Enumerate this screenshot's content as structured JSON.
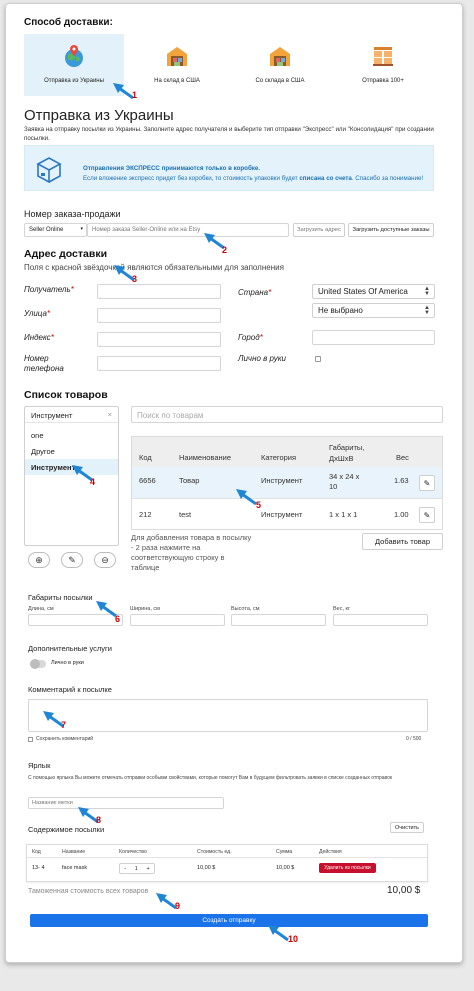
{
  "shipping": {
    "heading": "Способ доставки:",
    "options": [
      {
        "label": "Отправка из Украины",
        "active": true
      },
      {
        "label": "На склад в США",
        "active": false
      },
      {
        "label": "Со склада в США",
        "active": false
      },
      {
        "label": "Отправка 100+",
        "active": false
      }
    ]
  },
  "section": {
    "title": "Отправка из Украины",
    "description": "Заявка на отправку посылки из Украины. Заполните адрес получателя и выберите тип отправки \"Экспресс\" или \"Консолидация\" при создании посылки."
  },
  "banner": {
    "line1": "Отправления ЭКСПРЕСС принимаются только в коробке.",
    "line2_prefix": "Если вложение экспресс придет без коробки, то стоимость упаковки будет ",
    "line2_bold": "списана со счета",
    "line2_suffix": ". Спасибо за понимание!",
    "icon": "box-icon"
  },
  "order": {
    "label": "Номер заказа-продажи",
    "source_value": "Seller Online",
    "input_placeholder": "Номер заказа Seller-Online или на Etsy",
    "load_address": "Загрузить адрес",
    "load_available": "Загрузить доступные заказы"
  },
  "address": {
    "title": "Адрес доставки",
    "hint": "Поля с красной звёздочкой являются обязательными для заполнения",
    "recipient_label": "Получатель",
    "street_label": "Улица",
    "zip_label": "Индекс",
    "phone_label": "Номер телефона",
    "country_label": "Страна",
    "country_value": "United States Of America",
    "state_value": "Не выбрано",
    "city_label": "Город",
    "personal_label": "Лично в руки",
    "required_mark": "*"
  },
  "goods": {
    "title": "Список товаров",
    "category_filter": "Инструмент",
    "filter_clear": "×",
    "categories": [
      "one",
      "Другое",
      "Инструмент"
    ],
    "search_placeholder": "Поиск по товарам",
    "columns": [
      "Код",
      "Наименование",
      "Категория",
      "Габариты, ДxШxВ",
      "Вес"
    ],
    "rows": [
      {
        "code": "6656",
        "name": "Товар",
        "category": "Инструмент",
        "dims": "34 x 24 x 10",
        "weight": "1.63"
      },
      {
        "code": "212",
        "name": "test",
        "category": "Инструмент",
        "dims": "1 x 1 x 1",
        "weight": "1.00"
      }
    ],
    "add_hint": "Для добавления товара в посылку - 2 раза нажмите на соответствующую строку в таблице",
    "add_button": "Добавить товар",
    "icons": {
      "add": "⊕",
      "edit": "✎",
      "remove": "⊖"
    }
  },
  "parcel": {
    "title": "Габариты посылки",
    "length": "Длина, см",
    "width": "Ширина, см",
    "height": "Высота, см",
    "weight": "Вес, кг"
  },
  "services": {
    "title": "Дополнительные услуги",
    "personal": "Лично в руки"
  },
  "comment": {
    "title": "Комментарий к посылке",
    "save_label": "Сохранить комментарий",
    "counter": "0 / 500"
  },
  "tag": {
    "title": "Ярлык",
    "description": "С помощью ярлыка Вы можете отмечать отправки особыми свойствами, которые помогут Вам в будущем фильтровать заявки в списке созданных отправок",
    "placeholder": "Название метки"
  },
  "contents": {
    "title": "Содержимое посылки",
    "clear_button": "Очистить",
    "columns": [
      "Код",
      "Название",
      "Количество",
      "Стоимость ед.",
      "Сумма",
      "Действия"
    ],
    "row": {
      "code": "13- 4",
      "name": "face mask",
      "qty_minus": "-",
      "qty": "1",
      "qty_plus": "+",
      "unit": "10,00 $",
      "sum": "10,00 $",
      "action": "Удалить из посылки"
    },
    "customs_label": "Таможенная стоимость всех товаров",
    "customs_value": "10,00 $"
  },
  "create_button": "Создать отправку",
  "callouts": [
    "1",
    "2",
    "3",
    "4",
    "5",
    "6",
    "7",
    "8",
    "9",
    "10"
  ],
  "colors": {
    "accent": "#1a73e8",
    "callout": "#d20000",
    "arrow": "#1f86d6"
  }
}
